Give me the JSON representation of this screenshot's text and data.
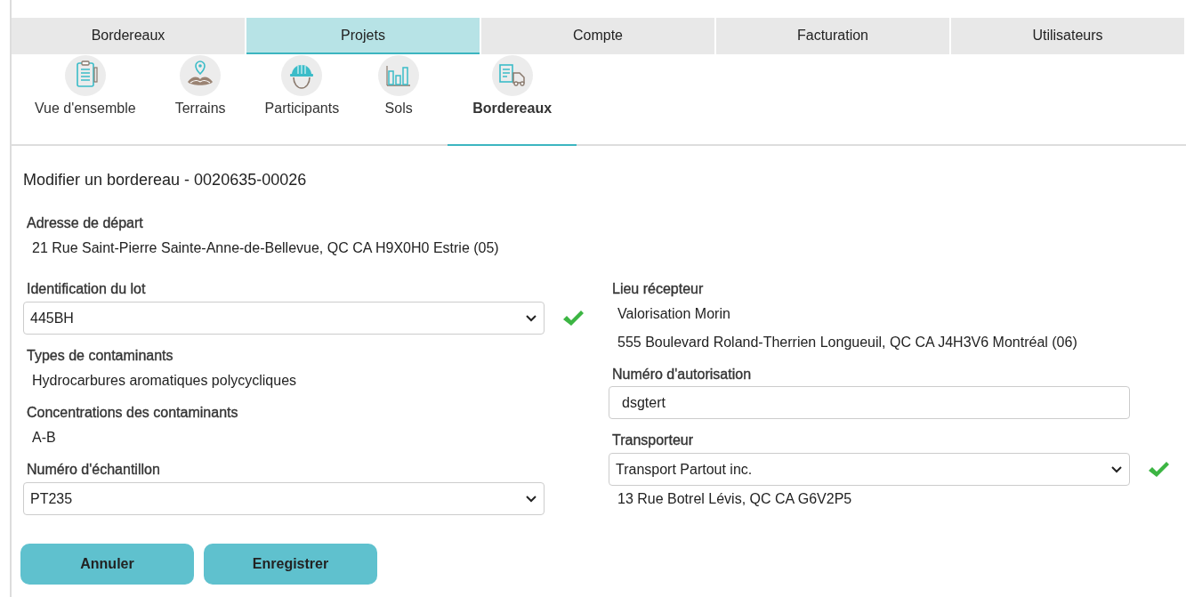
{
  "main_tabs": [
    {
      "label": "Bordereaux",
      "selected": false
    },
    {
      "label": "Projets",
      "selected": true
    },
    {
      "label": "Compte",
      "selected": false
    },
    {
      "label": "Facturation",
      "selected": false
    },
    {
      "label": "Utilisateurs",
      "selected": false
    }
  ],
  "sub_tabs": [
    {
      "label": "Vue d'ensemble",
      "selected": false
    },
    {
      "label": "Terrains",
      "selected": false
    },
    {
      "label": "Participants",
      "selected": false
    },
    {
      "label": "Sols",
      "selected": false
    },
    {
      "label": "Bordereaux",
      "selected": true
    }
  ],
  "form": {
    "title": "Modifier un bordereau - 0020635-00026",
    "departure": {
      "label": "Adresse de départ",
      "lines": [
        "21 Rue Saint-Pierre Sainte-Anne-de-Bellevue, QC CA H9X0H0 Estrie (05)"
      ]
    },
    "left": [
      {
        "kind": "select",
        "label": "Identification du lot",
        "value": "445BH",
        "valid": true
      },
      {
        "kind": "info",
        "label": "Types de contaminants",
        "lines": [
          "Hydrocarbures aromatiques polycycliques"
        ]
      },
      {
        "kind": "info",
        "label": "Concentrations des contaminants",
        "lines": [
          "A-B"
        ]
      },
      {
        "kind": "select",
        "label": "Numéro d'échantillon",
        "value": "PT235",
        "valid": false
      }
    ],
    "right": [
      {
        "kind": "info",
        "label": "Lieu récepteur",
        "lines": [
          "Valorisation Morin",
          "555 Boulevard Roland-Therrien Longueuil, QC CA J4H3V6 Montréal (06)"
        ]
      },
      {
        "kind": "input",
        "label": "Numéro d'autorisation",
        "value": "dsgtert"
      },
      {
        "kind": "select",
        "label": "Transporteur",
        "value": "Transport Partout inc.",
        "valid": true,
        "lines": [
          "13 Rue Botrel Lévis, QC CA G6V2P5"
        ]
      }
    ]
  },
  "buttons": [
    "Annuler",
    "Enregistrer"
  ]
}
